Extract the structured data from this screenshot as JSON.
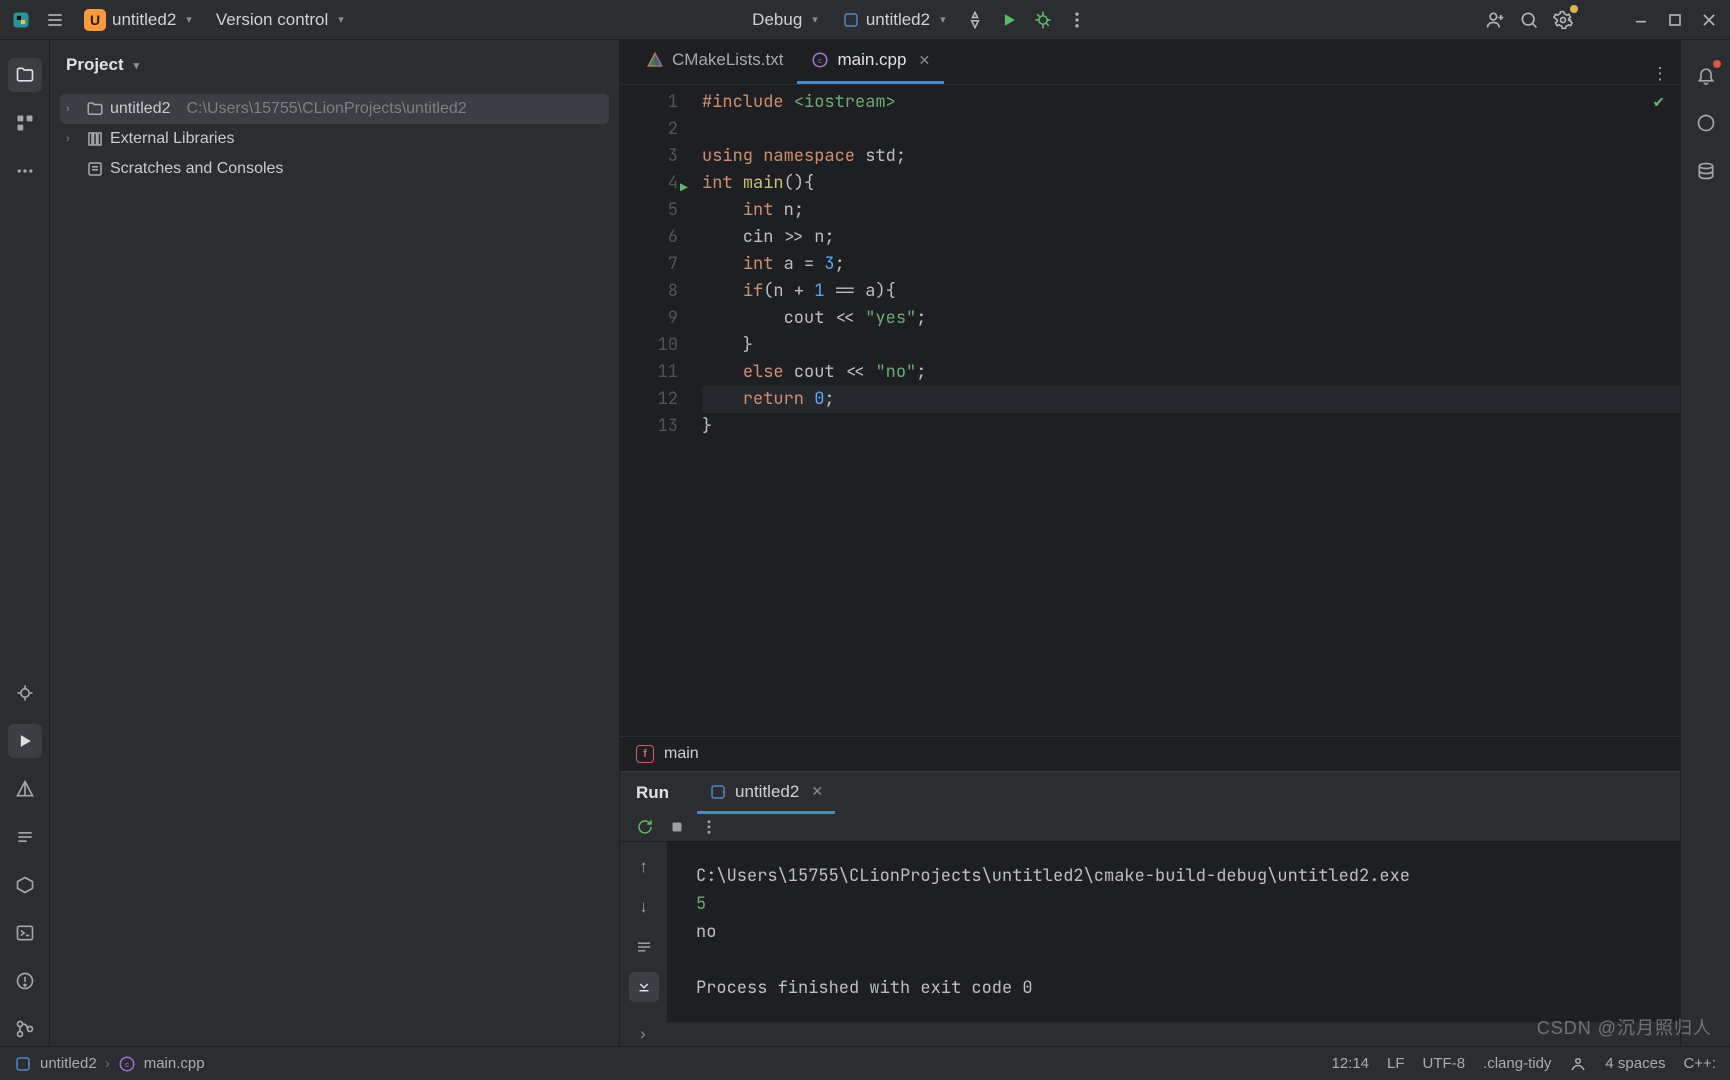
{
  "topbar": {
    "project_badge": "U",
    "project_name": "untitled2",
    "vcs_label": "Version control",
    "config_label": "Debug",
    "run_target": "untitled2"
  },
  "sidebar": {
    "title": "Project",
    "tree": {
      "root_name": "untitled2",
      "root_path": "C:\\Users\\15755\\CLionProjects\\untitled2",
      "external": "External Libraries",
      "scratches": "Scratches and Consoles"
    }
  },
  "tabs": {
    "items": [
      {
        "label": "CMakeLists.txt",
        "active": false,
        "icon": "cmake"
      },
      {
        "label": "main.cpp",
        "active": true,
        "icon": "cpp"
      }
    ]
  },
  "code": {
    "run_marker_line": 4,
    "highlight_line": 12,
    "lines": [
      {
        "n": 1,
        "html": "<span class='kw'>#include</span> <span class='inc'>&lt;iostream&gt;</span>"
      },
      {
        "n": 2,
        "html": ""
      },
      {
        "n": 3,
        "html": "<span class='kw'>using namespace</span> <span class='ns'>std</span>;"
      },
      {
        "n": 4,
        "html": "<span class='kw'>int</span> <span class='fn'>main</span>(){"
      },
      {
        "n": 5,
        "html": "    <span class='kw'>int</span> n;"
      },
      {
        "n": 6,
        "html": "    cin <span class='op'>&gt;&gt;</span> n;"
      },
      {
        "n": 7,
        "html": "    <span class='kw'>int</span> a = <span class='num'>3</span>;"
      },
      {
        "n": 8,
        "html": "    <span class='kw'>if</span>(n + <span class='num'>1</span> == a){"
      },
      {
        "n": 9,
        "html": "        cout <span class='op'>&lt;&lt;</span> <span class='str'>\"yes\"</span>;"
      },
      {
        "n": 10,
        "html": "    }"
      },
      {
        "n": 11,
        "html": "    <span class='kw'>else</span> cout <span class='op'>&lt;&lt;</span> <span class='str'>\"no\"</span>;"
      },
      {
        "n": 12,
        "html": "    <span class='kw'>return</span> <span class='num'>0</span>;"
      },
      {
        "n": 13,
        "html": "}"
      }
    ]
  },
  "crumb": {
    "label": "main"
  },
  "run": {
    "title": "Run",
    "tab_label": "untitled2",
    "cmd": "C:\\Users\\15755\\CLionProjects\\untitled2\\cmake-build-debug\\untitled2.exe",
    "input": "5",
    "output": "no",
    "exit": "Process finished with exit code 0"
  },
  "nav_trail": {
    "project": "untitled2",
    "file": "main.cpp"
  },
  "status": {
    "pos": "12:14",
    "eol": "LF",
    "encoding": "UTF-8",
    "linter": ".clang-tidy",
    "indent": "4 spaces",
    "lang": "C++:"
  },
  "watermark": "CSDN @沉月照归人"
}
